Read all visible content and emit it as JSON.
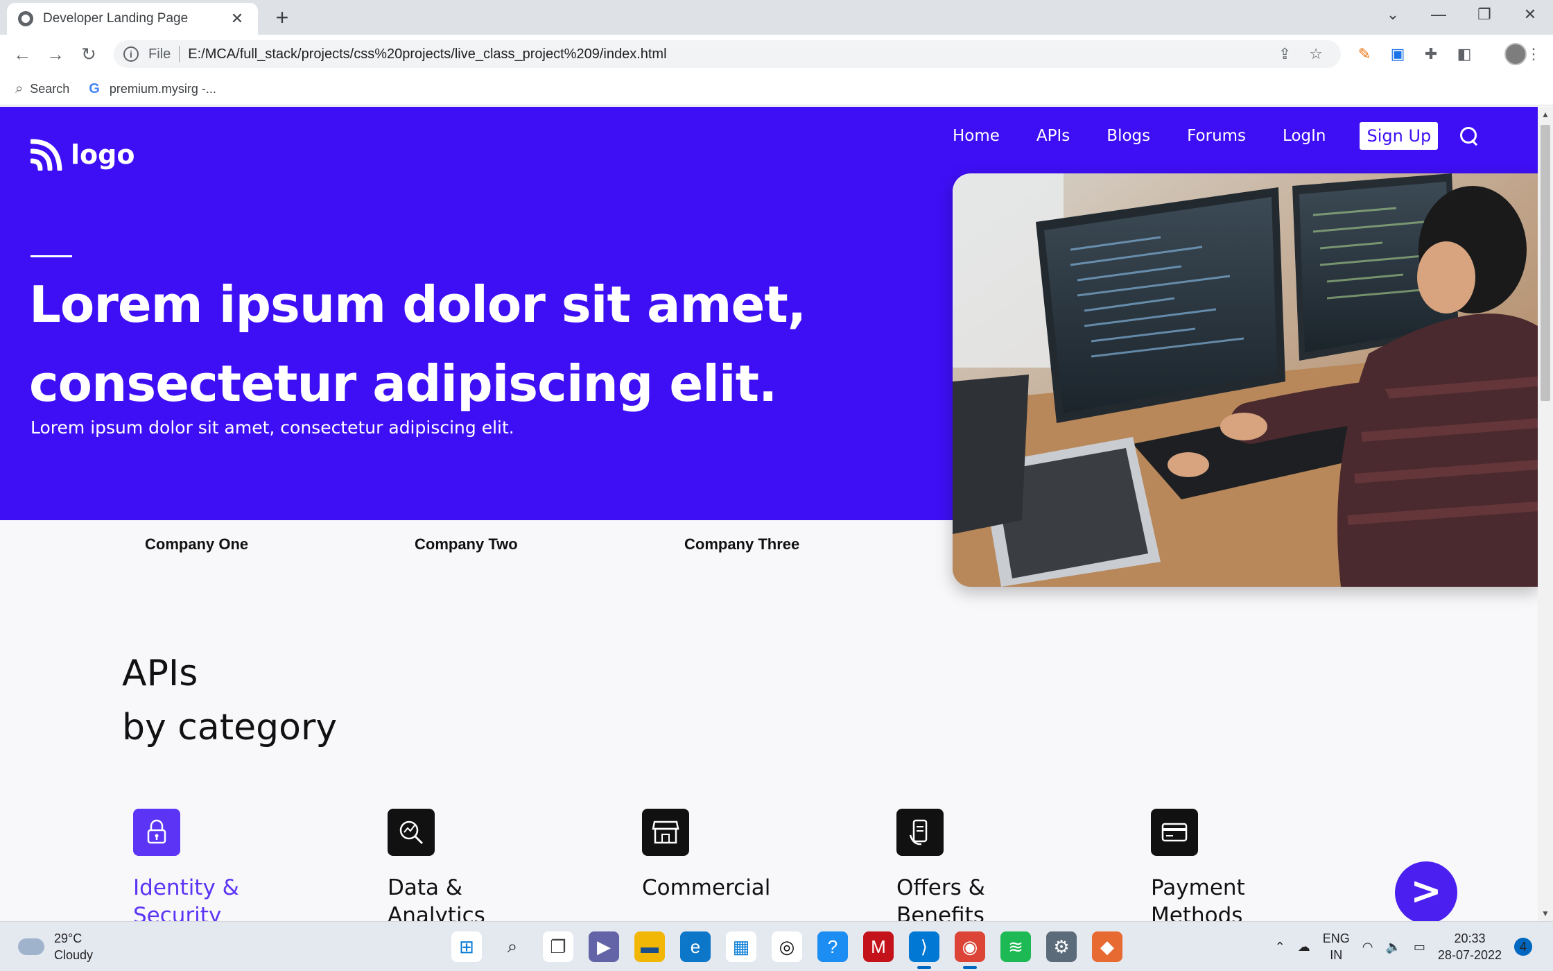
{
  "browser": {
    "tab_title": "Developer Landing Page",
    "tab_close": "✕",
    "new_tab": "+",
    "window_controls": [
      "⌄",
      "—",
      "❐",
      "✕"
    ],
    "scheme": "File",
    "url": "E:/MCA/full_stack/projects/css%20projects/live_class_project%209/index.html",
    "bookmarks": [
      {
        "label": "Search",
        "icon": "search-icon"
      },
      {
        "label": "premium.mysirg -...",
        "icon": "google-icon"
      }
    ]
  },
  "hero": {
    "logo_text": "logo",
    "nav": [
      "Home",
      "APIs",
      "Blogs",
      "Forums",
      "LogIn"
    ],
    "signup_label": "Sign Up",
    "headline_line1": "Lorem ipsum dolor sit amet,",
    "headline_line2": "consectetur adipiscing elit.",
    "subheading": "Lorem ipsum dolor sit amet, consectetur adipiscing elit.",
    "image_alt": "developer-at-computer-photo",
    "accent_color": "#3e0ff5"
  },
  "companies": [
    "Company One",
    "Company Two",
    "Company Three"
  ],
  "apis": {
    "title_line1": "APIs",
    "title_line2": "by category",
    "categories": [
      {
        "line1": "Identity &",
        "line2": "Security",
        "icon": "lock-icon",
        "active": true
      },
      {
        "line1": "Data &",
        "line2": "Analytics",
        "icon": "analytics-icon",
        "active": false
      },
      {
        "line1": "Commercial",
        "line2": "",
        "icon": "store-icon",
        "active": false
      },
      {
        "line1": "Offers &",
        "line2": "Benefits",
        "icon": "offers-icon",
        "active": false
      },
      {
        "line1": "Payment",
        "line2": "Methods",
        "icon": "card-icon",
        "active": false
      }
    ],
    "next_button": ">"
  },
  "taskbar": {
    "temperature": "29°C",
    "weather": "Cloudy",
    "lang_line1": "ENG",
    "lang_line2": "IN",
    "time": "20:33",
    "date": "28-07-2022",
    "notifications": "4"
  }
}
